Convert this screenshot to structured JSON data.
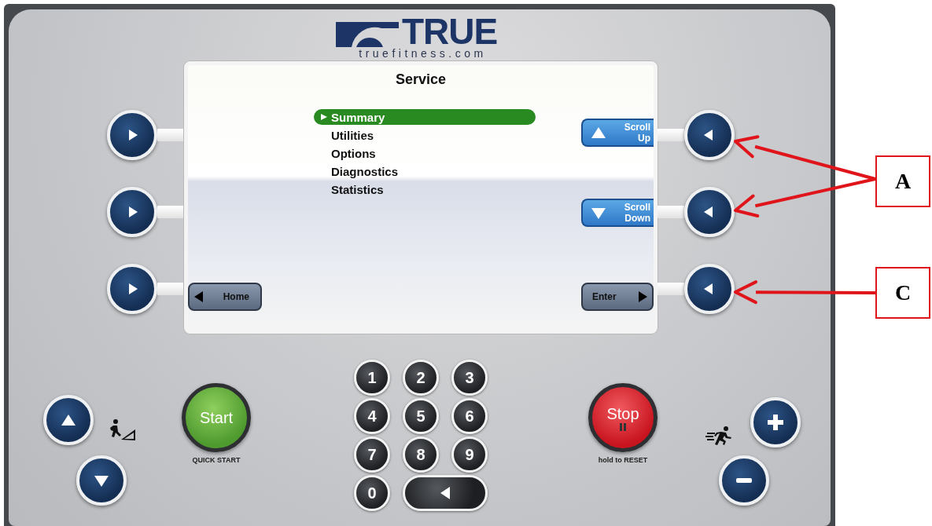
{
  "logo": {
    "brand": "TRUE",
    "website": "truefitness.com"
  },
  "screen": {
    "title": "Service",
    "menu": [
      {
        "label": "Summary",
        "selected": true
      },
      {
        "label": "Utilities",
        "selected": false
      },
      {
        "label": "Options",
        "selected": false
      },
      {
        "label": "Diagnostics",
        "selected": false
      },
      {
        "label": "Statistics",
        "selected": false
      }
    ],
    "soft_keys": [
      {
        "label": "Scroll Up",
        "kind": "up"
      },
      {
        "label": "Scroll Down",
        "kind": "down"
      },
      {
        "label": "Home",
        "kind": "back"
      },
      {
        "label": "Enter",
        "kind": "forward"
      }
    ]
  },
  "start": {
    "label": "Start",
    "caption": "QUICK START"
  },
  "keypad": [
    "1",
    "2",
    "3",
    "4",
    "5",
    "6",
    "7",
    "8",
    "9",
    "0"
  ],
  "stop": {
    "label": "Stop",
    "caption": "hold to RESET"
  },
  "callouts": [
    {
      "label": "A"
    },
    {
      "label": "C"
    }
  ]
}
